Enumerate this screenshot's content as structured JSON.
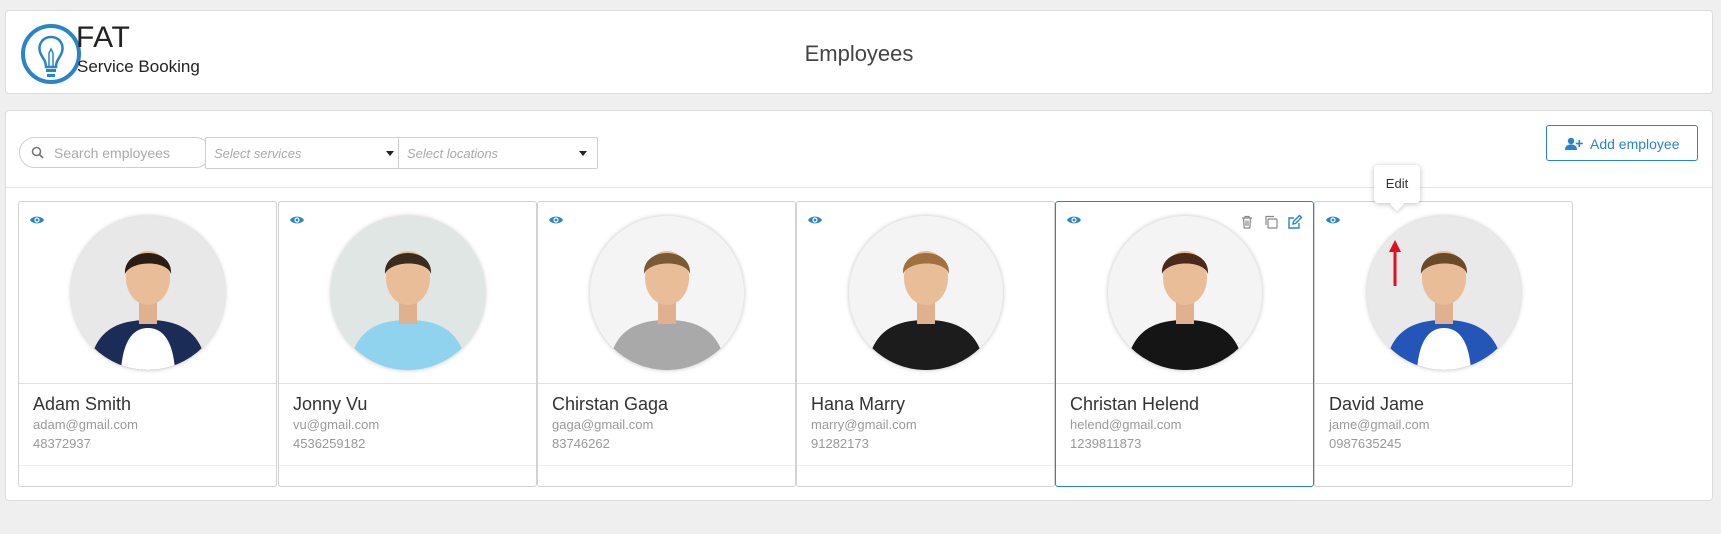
{
  "brand": {
    "title": "FAT",
    "subtitle": "Service Booking"
  },
  "page": {
    "title": "Employees"
  },
  "toolbar": {
    "search_placeholder": "Search employees",
    "services_placeholder": "Select services",
    "locations_placeholder": "Select locations",
    "add_label": "Add employee"
  },
  "tooltip": {
    "label": "Edit"
  },
  "colors": {
    "accent": "#2a84c8",
    "annotation": "#e01020"
  },
  "employees": [
    {
      "name": "Adam Smith",
      "email": "adam@gmail.com",
      "phone": "48372937",
      "shirt": "#ffffff",
      "jacket": "#1b2d56",
      "hair": "#2b1d14",
      "bg": "#e8e8e8"
    },
    {
      "name": "Jonny Vu",
      "email": "vu@gmail.com",
      "phone": "4536259182",
      "shirt": "#8fd3ee",
      "jacket": "#8fd3ee",
      "hair": "#3b2a1e",
      "bg": "#dfe6e3"
    },
    {
      "name": "Chirstan Gaga",
      "email": "gaga@gmail.com",
      "phone": "83746262",
      "shirt": "#a9a9a9",
      "jacket": "#a9a9a9",
      "hair": "#7a5a34",
      "bg": "#f4f4f4"
    },
    {
      "name": "Hana Marry",
      "email": "marry@gmail.com",
      "phone": "91282173",
      "shirt": "#1c1c1c",
      "jacket": "#1c1c1c",
      "hair": "#a07040",
      "bg": "#f4f4f4"
    },
    {
      "name": "Christan Helend",
      "email": "helend@gmail.com",
      "phone": "1239811873",
      "shirt": "#151515",
      "jacket": "#151515",
      "hair": "#4a2a18",
      "bg": "#f4f4f4"
    },
    {
      "name": "David Jame",
      "email": "jame@gmail.com",
      "phone": "0987635245",
      "shirt": "#ffffff",
      "jacket": "#2456b8",
      "hair": "#6b4a2a",
      "bg": "#e9e9e9"
    }
  ]
}
